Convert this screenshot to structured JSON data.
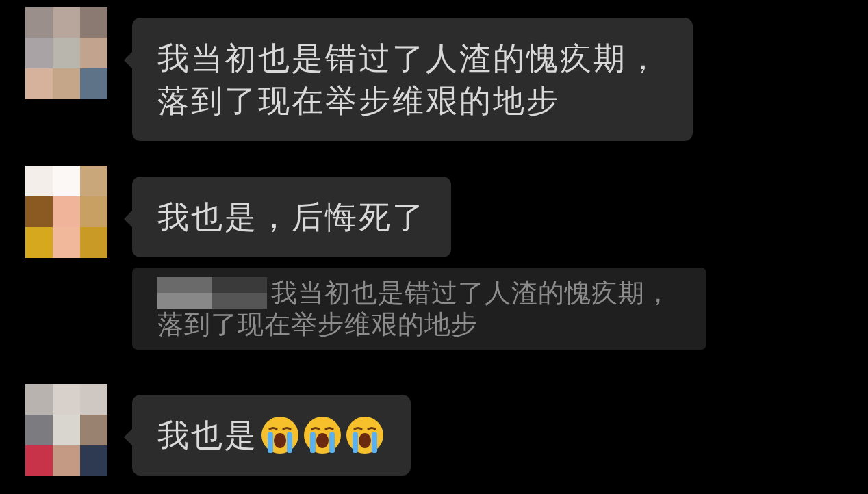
{
  "messages": [
    {
      "kind": "text",
      "text": "我当初也是错过了人渣的愧疚期，落到了现在举步维艰的地步"
    },
    {
      "kind": "text",
      "text": "我也是，后悔死了"
    },
    {
      "kind": "quote",
      "text": "我当初也是错过了人渣的愧疚期，落到了现在举步维艰的地步"
    },
    {
      "kind": "text",
      "text": "我也是",
      "icons": [
        {
          "kind": "crying-face"
        },
        {
          "kind": "crying-face"
        },
        {
          "kind": "crying-face"
        }
      ]
    }
  ]
}
